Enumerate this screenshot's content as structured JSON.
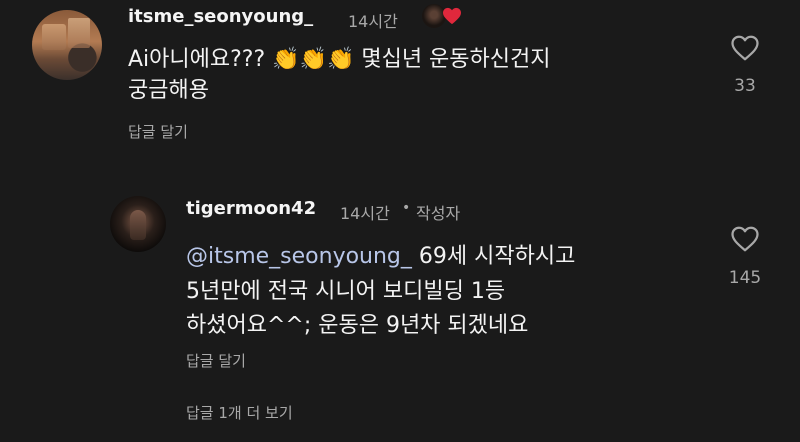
{
  "comment": {
    "username": "itsme_seonyoung_",
    "time": "14시간",
    "text_line1_prefix": "Ai아니에요???",
    "claps": "👏👏👏",
    "text_line1_suffix": "몇십년 운동하신건지",
    "text_line2": "궁금해용",
    "reply_action": "답글 달기",
    "like_count": "33"
  },
  "reply": {
    "username": "tigermoon42",
    "time": "14시간",
    "separator": "•",
    "author_badge": "작성자",
    "mention": "@itsme_seonyoung_",
    "text_line1_suffix": "69세 시작하시고",
    "text_line2": "5년만에 전국 시니어 보디빌딩 1등",
    "text_line3": "하셨어요^^; 운동은 9년차 되겠네요",
    "reply_action": "답글 달기",
    "like_count": "145"
  },
  "more_replies": "답글 1개 더 보기",
  "colors": {
    "background": "#1a1a1a",
    "text_primary": "#f3f3f3",
    "text_secondary": "#a8a8a8",
    "mention": "#b8c6e8",
    "liked_heart": "#e0283c"
  },
  "icons": {
    "like": "heart-outline-icon",
    "creator_liked": "heart-filled-icon"
  }
}
